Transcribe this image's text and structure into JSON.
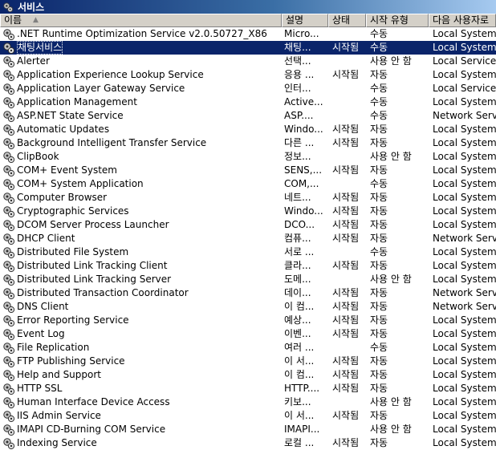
{
  "window": {
    "title": "서비스"
  },
  "columns": {
    "name": "이름",
    "description": "설명",
    "status": "상태",
    "startup": "시작 유형",
    "logon": "다음 사용자로"
  },
  "services": [
    {
      "name": ".NET Runtime Optimization Service v2.0.50727_X86",
      "description": "Micro...",
      "status": "",
      "startup": "수동",
      "logon": "Local System"
    },
    {
      "name": "채팅서비스",
      "description": "채팅...",
      "status": "시작됨",
      "startup": "수동",
      "logon": "Local System"
    },
    {
      "name": "Alerter",
      "description": "선택...",
      "status": "",
      "startup": "사용 안 함",
      "logon": "Local Service"
    },
    {
      "name": "Application Experience Lookup Service",
      "description": "응용 ...",
      "status": "시작됨",
      "startup": "자동",
      "logon": "Local System"
    },
    {
      "name": "Application Layer Gateway Service",
      "description": "인터...",
      "status": "",
      "startup": "수동",
      "logon": "Local Service"
    },
    {
      "name": "Application Management",
      "description": "Active...",
      "status": "",
      "startup": "수동",
      "logon": "Local System"
    },
    {
      "name": "ASP.NET State Service",
      "description": "ASP....",
      "status": "",
      "startup": "수동",
      "logon": "Network Servic"
    },
    {
      "name": "Automatic Updates",
      "description": "Windo...",
      "status": "시작됨",
      "startup": "자동",
      "logon": "Local System"
    },
    {
      "name": "Background Intelligent Transfer Service",
      "description": "다른 ...",
      "status": "시작됨",
      "startup": "자동",
      "logon": "Local System"
    },
    {
      "name": "ClipBook",
      "description": "정보...",
      "status": "",
      "startup": "사용 안 함",
      "logon": "Local System"
    },
    {
      "name": "COM+ Event System",
      "description": "SENS,...",
      "status": "시작됨",
      "startup": "자동",
      "logon": "Local System"
    },
    {
      "name": "COM+ System Application",
      "description": "COM,...",
      "status": "",
      "startup": "수동",
      "logon": "Local System"
    },
    {
      "name": "Computer Browser",
      "description": "네트...",
      "status": "시작됨",
      "startup": "자동",
      "logon": "Local System"
    },
    {
      "name": "Cryptographic Services",
      "description": "Windo...",
      "status": "시작됨",
      "startup": "자동",
      "logon": "Local System"
    },
    {
      "name": "DCOM Server Process Launcher",
      "description": "DCO...",
      "status": "시작됨",
      "startup": "자동",
      "logon": "Local System"
    },
    {
      "name": "DHCP Client",
      "description": "컴퓨...",
      "status": "시작됨",
      "startup": "자동",
      "logon": "Network Servic"
    },
    {
      "name": "Distributed File System",
      "description": "서로 ...",
      "status": "",
      "startup": "수동",
      "logon": "Local System"
    },
    {
      "name": "Distributed Link Tracking Client",
      "description": "클라...",
      "status": "시작됨",
      "startup": "자동",
      "logon": "Local System"
    },
    {
      "name": "Distributed Link Tracking Server",
      "description": "도메...",
      "status": "",
      "startup": "사용 안 함",
      "logon": "Local System"
    },
    {
      "name": "Distributed Transaction Coordinator",
      "description": "데이...",
      "status": "시작됨",
      "startup": "자동",
      "logon": "Network Servic"
    },
    {
      "name": "DNS Client",
      "description": "이 컴...",
      "status": "시작됨",
      "startup": "자동",
      "logon": "Network Servic"
    },
    {
      "name": "Error Reporting Service",
      "description": "예상...",
      "status": "시작됨",
      "startup": "자동",
      "logon": "Local System"
    },
    {
      "name": "Event Log",
      "description": "이벤...",
      "status": "시작됨",
      "startup": "자동",
      "logon": "Local System"
    },
    {
      "name": "File Replication",
      "description": "여러 ...",
      "status": "",
      "startup": "수동",
      "logon": "Local System"
    },
    {
      "name": "FTP Publishing Service",
      "description": "이 서...",
      "status": "시작됨",
      "startup": "자동",
      "logon": "Local System"
    },
    {
      "name": "Help and Support",
      "description": "이 컴...",
      "status": "시작됨",
      "startup": "자동",
      "logon": "Local System"
    },
    {
      "name": "HTTP SSL",
      "description": "HTTP....",
      "status": "시작됨",
      "startup": "자동",
      "logon": "Local System"
    },
    {
      "name": "Human Interface Device Access",
      "description": "키보...",
      "status": "",
      "startup": "사용 안 함",
      "logon": "Local System"
    },
    {
      "name": "IIS Admin Service",
      "description": "이 서...",
      "status": "시작됨",
      "startup": "자동",
      "logon": "Local System"
    },
    {
      "name": "IMAPI CD-Burning COM Service",
      "description": "IMAPI...",
      "status": "",
      "startup": "사용 안 함",
      "logon": "Local System"
    },
    {
      "name": "Indexing Service",
      "description": "로컬 ...",
      "status": "시작됨",
      "startup": "자동",
      "logon": "Local System"
    }
  ],
  "selected_index": 1,
  "sort": {
    "column": "name",
    "direction": "ascending"
  }
}
